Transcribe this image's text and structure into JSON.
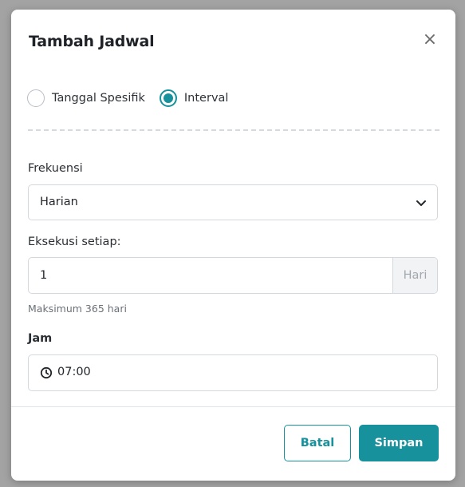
{
  "dialog": {
    "title": "Tambah Jadwal",
    "close_symbol": "×"
  },
  "schedule_type": {
    "options": [
      {
        "label": "Tanggal Spesifik",
        "checked": false
      },
      {
        "label": "Interval",
        "checked": true
      }
    ]
  },
  "frequency": {
    "label": "Frekuensi",
    "selected": "Harian"
  },
  "interval": {
    "label": "Eksekusi setiap:",
    "value": "1",
    "unit": "Hari",
    "helper": "Maksimum 365 hari"
  },
  "time": {
    "label": "Jam",
    "value": "07:00"
  },
  "footer": {
    "cancel_label": "Batal",
    "save_label": "Simpan"
  },
  "colors": {
    "accent": "#17919b",
    "backdrop": "#a3a3a3"
  },
  "icons": {
    "close": "close-icon",
    "chevron": "chevron-down-icon",
    "clock": "clock-icon"
  }
}
